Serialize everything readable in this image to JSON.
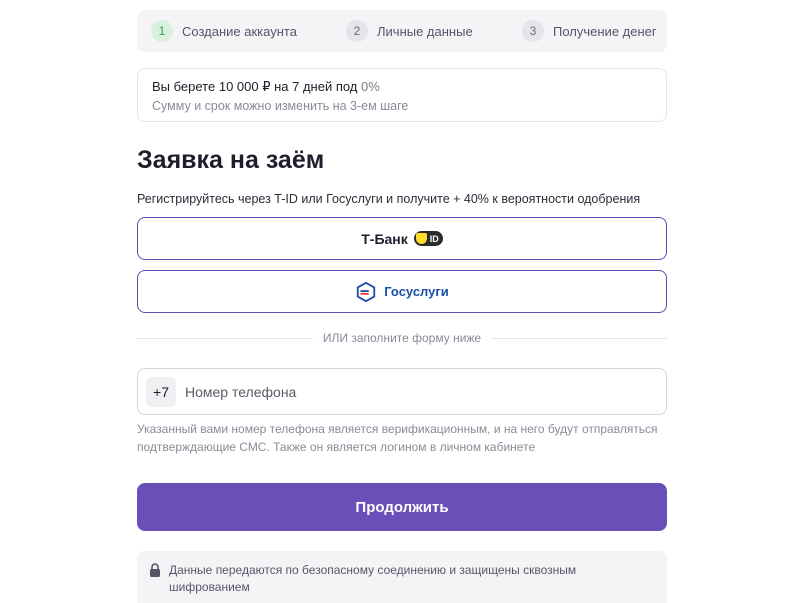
{
  "steps": [
    {
      "num": "1",
      "label": "Создание аккаунта",
      "active": true
    },
    {
      "num": "2",
      "label": "Личные данные",
      "active": false
    },
    {
      "num": "3",
      "label": "Получение денег",
      "active": false
    }
  ],
  "offer": {
    "prefix": "Вы берете 10 000 ₽ на 7 дней под ",
    "rate": "0%",
    "note": "Сумму и срок можно изменить на 3-ем шаге"
  },
  "title": "Заявка на заём",
  "subtitle": "Регистрируйтесь через T-ID или Госуслуги и получите + 40% к вероятности одобрения",
  "auth": {
    "tbank_label": "Т-Банк",
    "tid_badge": "ID",
    "gosuslugi_label": "Госуслуги"
  },
  "divider_text": "ИЛИ заполните форму ниже",
  "phone": {
    "prefix": "+7",
    "placeholder": "Номер телефона",
    "value": ""
  },
  "phone_hint": "Указанный вами номер телефона является верификационным, и на него будут отправляться подтверждающие СМС. Также он является логином в личном кабинете",
  "submit_label": "Продолжить",
  "secure_note": "Данные передаются по безопасному соединению и защищены сквозным шифрованием",
  "colors": {
    "accent": "#6a4fb8",
    "gosuslugi_blue": "#1a4fa8",
    "gosuslugi_red": "#e63a3a",
    "step_active": "#3aa35a",
    "tid_yellow": "#ffdd2d"
  },
  "icons": {
    "tid": "tid-shield-icon",
    "gosuslugi": "gosuslugi-logo-icon",
    "secure": "lock-icon"
  }
}
